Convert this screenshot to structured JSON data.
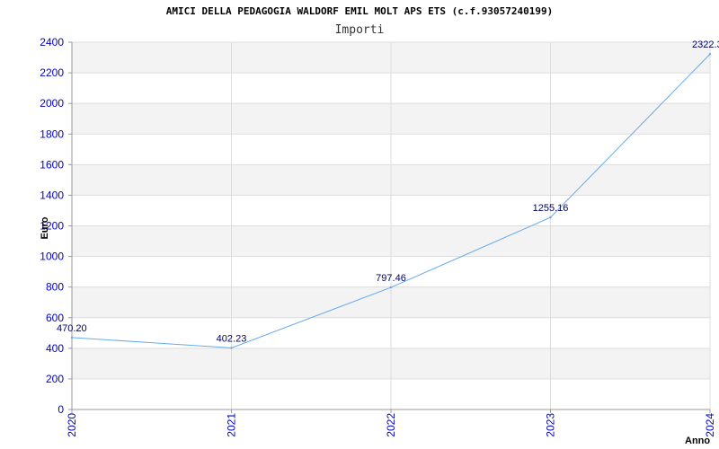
{
  "chart_data": {
    "type": "line",
    "title": "AMICI DELLA PEDAGOGIA WALDORF EMIL MOLT APS ETS (c.f.93057240199)",
    "subtitle": "Importi",
    "xlabel": "Anno",
    "ylabel": "Euro",
    "x": [
      "2020",
      "2021",
      "2022",
      "2023",
      "2024"
    ],
    "values": [
      470.2,
      402.23,
      797.46,
      1255.16,
      2322.3
    ],
    "data_labels": [
      "470.20",
      "402.23",
      "797.46",
      "1255.16",
      "2322.3"
    ],
    "ylim": [
      0,
      2400
    ],
    "yticks": [
      "0",
      "200",
      "400",
      "600",
      "800",
      "1000",
      "1200",
      "1400",
      "1600",
      "1800",
      "2000",
      "2200",
      "2400"
    ],
    "grid": true,
    "colors": {
      "line": "#66aaee",
      "band": "#f3f3f3",
      "tick_text": "#0000cc",
      "label_text": "#000066"
    }
  }
}
